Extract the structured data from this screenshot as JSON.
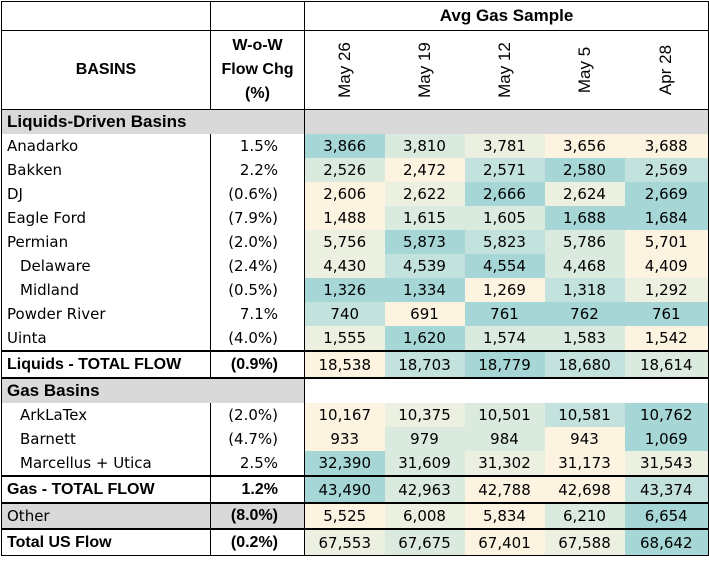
{
  "header": {
    "group_title": "Avg Gas Sample",
    "basins_label": "BASINS",
    "wow_line1": "W-o-W",
    "wow_line2": "Flow Chg",
    "wow_line3": "(%)",
    "dates": [
      "May 26",
      "May 19",
      "May 12",
      "May 5",
      "Apr 28"
    ]
  },
  "sections": {
    "liquids": {
      "title": "Liquids-Driven Basins",
      "rows": [
        {
          "name": "Anadarko",
          "chg": "1.5%",
          "values": [
            "3,866",
            "3,810",
            "3,781",
            "3,656",
            "3,688"
          ]
        },
        {
          "name": "Bakken",
          "chg": "2.2%",
          "values": [
            "2,526",
            "2,472",
            "2,571",
            "2,580",
            "2,569"
          ]
        },
        {
          "name": "DJ",
          "chg": "(0.6%)",
          "values": [
            "2,606",
            "2,622",
            "2,666",
            "2,624",
            "2,669"
          ]
        },
        {
          "name": "Eagle Ford",
          "chg": "(7.9%)",
          "values": [
            "1,488",
            "1,615",
            "1,605",
            "1,688",
            "1,684"
          ]
        },
        {
          "name": "Permian",
          "chg": "(2.0%)",
          "values": [
            "5,756",
            "5,873",
            "5,823",
            "5,786",
            "5,701"
          ]
        },
        {
          "name": "Delaware",
          "chg": "(2.4%)",
          "values": [
            "4,430",
            "4,539",
            "4,554",
            "4,468",
            "4,409"
          ]
        },
        {
          "name": "Midland",
          "chg": "(0.5%)",
          "values": [
            "1,326",
            "1,334",
            "1,269",
            "1,318",
            "1,292"
          ]
        },
        {
          "name": "Powder River",
          "chg": "7.1%",
          "values": [
            "740",
            "691",
            "761",
            "762",
            "761"
          ]
        },
        {
          "name": "Uinta",
          "chg": "(4.0%)",
          "values": [
            "1,555",
            "1,620",
            "1,574",
            "1,583",
            "1,542"
          ]
        }
      ],
      "total": {
        "name": "Liquids - TOTAL FLOW",
        "chg": "(0.9%)",
        "values": [
          "18,538",
          "18,703",
          "18,779",
          "18,680",
          "18,614"
        ]
      }
    },
    "gas": {
      "title": "Gas Basins",
      "rows": [
        {
          "name": "ArkLaTex",
          "chg": "(2.0%)",
          "values": [
            "10,167",
            "10,375",
            "10,501",
            "10,581",
            "10,762"
          ]
        },
        {
          "name": "Barnett",
          "chg": "(4.7%)",
          "values": [
            "933",
            "979",
            "984",
            "943",
            "1,069"
          ]
        },
        {
          "name": "Marcellus + Utica",
          "chg": "2.5%",
          "values": [
            "32,390",
            "31,609",
            "31,302",
            "31,173",
            "31,543"
          ]
        }
      ],
      "total": {
        "name": "Gas - TOTAL FLOW",
        "chg": "1.2%",
        "values": [
          "43,490",
          "42,963",
          "42,788",
          "42,698",
          "43,374"
        ]
      }
    },
    "other": {
      "name": "Other",
      "chg": "(8.0%)",
      "values": [
        "5,525",
        "6,008",
        "5,834",
        "6,210",
        "6,654"
      ]
    },
    "total_us": {
      "name": "Total US Flow",
      "chg": "(0.2%)",
      "values": [
        "67,553",
        "67,675",
        "67,401",
        "67,588",
        "68,642"
      ]
    }
  },
  "colors": {
    "section_fill": "#d9d9d9",
    "heat_darkest": "#a6d6d5",
    "heat_dark": "#c3e1dd",
    "heat_mid": "#dbeadf",
    "heat_light": "#ecf0e1",
    "heat_lightest": "#fcf3e1"
  }
}
